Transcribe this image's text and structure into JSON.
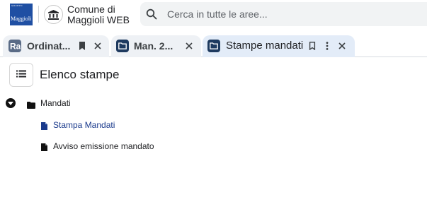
{
  "header": {
    "logo_top_text": "GRUPPO",
    "logo_text": "Maggioli",
    "entity_name_line1": "Comune di",
    "entity_name_line2": "Maggioli WEB",
    "search_placeholder": "Cerca in tutte le aree..."
  },
  "tabs": [
    {
      "label": "Ordinat...",
      "icon": "ra-app-icon",
      "active": false
    },
    {
      "label": "Man. 2...",
      "icon": "folder-app-icon",
      "active": false
    },
    {
      "label": "Stampe mandati",
      "icon": "folder-app-icon",
      "active": true
    }
  ],
  "page": {
    "title": "Elenco stampe"
  },
  "tree": {
    "root": {
      "label": "Mandati",
      "expanded": true
    },
    "items": [
      {
        "label": "Stampa Mandati",
        "selected": true
      },
      {
        "label": "Avviso emissione mandato",
        "selected": false
      }
    ]
  },
  "colors": {
    "brand": "#1f4fa3",
    "tab_icon": "#1e3a5f",
    "link": "#1a3a8c",
    "active_tab_bg": "#e3ecf8"
  }
}
